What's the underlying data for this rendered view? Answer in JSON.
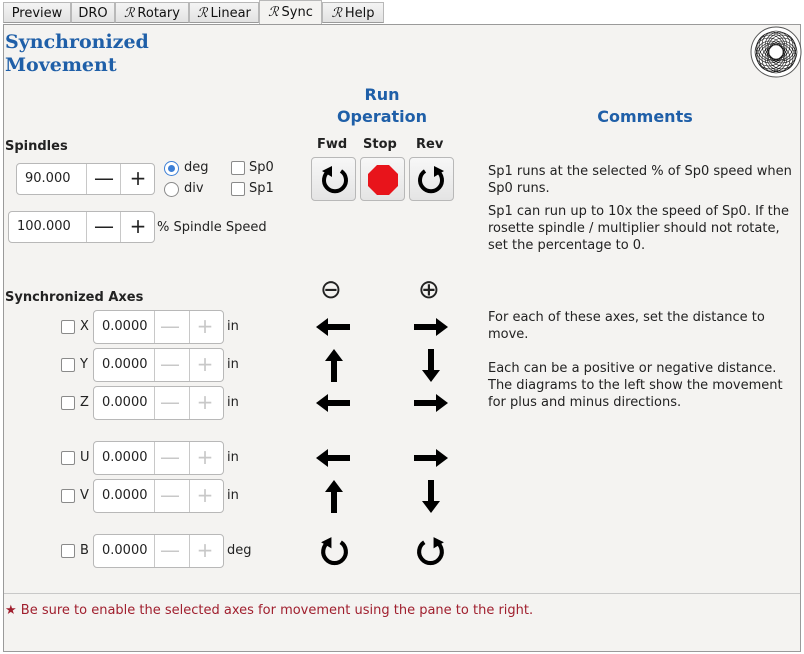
{
  "tabs": [
    {
      "label": "Preview",
      "script": false
    },
    {
      "label": "DRO",
      "script": false
    },
    {
      "label": "Rotary",
      "script": true
    },
    {
      "label": "Linear",
      "script": true
    },
    {
      "label": "Sync",
      "script": true,
      "active": true
    },
    {
      "label": "Help",
      "script": true
    }
  ],
  "tab_prefix": "ℛ",
  "title_line1": "Synchronized",
  "title_line2": "Movement",
  "run_operation": {
    "line1": "Run",
    "line2": "Operation",
    "fwd": "Fwd",
    "stop": "Stop",
    "rev": "Rev"
  },
  "comments_heading": "Comments",
  "spindles": {
    "label": "Spindles",
    "speed_value": "90.000",
    "unit_options": [
      {
        "label": "deg",
        "selected": true
      },
      {
        "label": "div",
        "selected": false
      }
    ],
    "spindle_checks": [
      {
        "label": "Sp0",
        "checked": false
      },
      {
        "label": "Sp1",
        "checked": false
      }
    ],
    "pct_value": "100.000",
    "pct_label": "% Spindle Speed",
    "minus": "—",
    "plus": "+"
  },
  "spindle_comments": [
    "Sp1 runs at the selected % of Sp0 speed when Sp0 runs.",
    "Sp1 can run up to 10x the speed of Sp0.  If the rosette spindle / multiplier should not rotate, set the percentage to 0."
  ],
  "sync_axes": {
    "label": "Synchronized Axes",
    "minus_symbol": "⊖",
    "plus_symbol": "⊕",
    "axes": [
      {
        "name": "X",
        "value": "0.0000",
        "unit": "in",
        "minus_icon": "arrow-left-icon",
        "plus_icon": "arrow-right-icon"
      },
      {
        "name": "Y",
        "value": "0.0000",
        "unit": "in",
        "minus_icon": "arrow-up-icon",
        "plus_icon": "arrow-down-icon"
      },
      {
        "name": "Z",
        "value": "0.0000",
        "unit": "in",
        "minus_icon": "arrow-left-icon",
        "plus_icon": "arrow-right-icon"
      },
      {
        "name": "U",
        "value": "0.0000",
        "unit": "in",
        "minus_icon": "arrow-left-icon",
        "plus_icon": "arrow-right-icon"
      },
      {
        "name": "V",
        "value": "0.0000",
        "unit": "in",
        "minus_icon": "arrow-up-icon",
        "plus_icon": "arrow-down-icon"
      },
      {
        "name": "B",
        "value": "0.0000",
        "unit": "deg",
        "minus_icon": "rotate-ccw-icon",
        "plus_icon": "rotate-cw-icon"
      }
    ]
  },
  "axes_comments": [
    "For each of these axes, set the distance to move.",
    "Each can be a positive or negative distance. The diagrams to the left show the movement for plus and minus directions."
  ],
  "warning": "★ Be sure to enable the selected axes for movement using the pane to the right.",
  "colors": {
    "heading": "#1f5fa8",
    "warning": "#a01f2e",
    "stop": "#e8141b",
    "radio": "#3d7fd6"
  }
}
